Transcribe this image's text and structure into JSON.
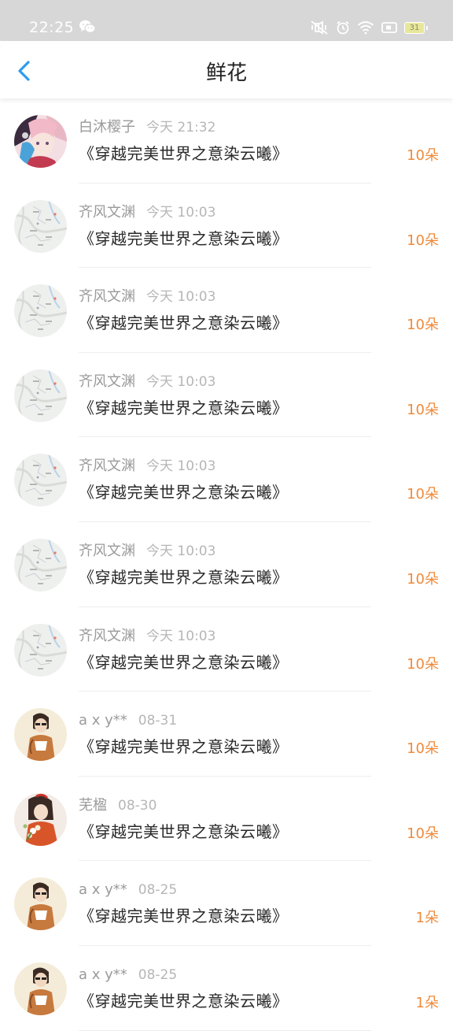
{
  "status_bar": {
    "time": "22:25",
    "left_icon": "wechat-icon",
    "right_icons": [
      "mute-vibrate-icon",
      "alarm-icon",
      "wifi-icon",
      "screen-record-icon",
      "battery-icon"
    ],
    "battery_level": "31"
  },
  "header": {
    "back_icon": "chevron-left-icon",
    "title": "鲜花"
  },
  "colors": {
    "accent": "#2f9bf0",
    "count": "#ef8a3a"
  },
  "flowers": [
    {
      "name": "白沐樱子",
      "time": "今天 21:32",
      "book": "《穿越完美世界之意染云曦》",
      "count": "10朵",
      "avatar": "anime-avatar"
    },
    {
      "name": "齐风文渊",
      "time": "今天 10:03",
      "book": "《穿越完美世界之意染云曦》",
      "count": "10朵",
      "avatar": "map-avatar"
    },
    {
      "name": "齐风文渊",
      "time": "今天 10:03",
      "book": "《穿越完美世界之意染云曦》",
      "count": "10朵",
      "avatar": "map-avatar"
    },
    {
      "name": "齐风文渊",
      "time": "今天 10:03",
      "book": "《穿越完美世界之意染云曦》",
      "count": "10朵",
      "avatar": "map-avatar"
    },
    {
      "name": "齐风文渊",
      "time": "今天 10:03",
      "book": "《穿越完美世界之意染云曦》",
      "count": "10朵",
      "avatar": "map-avatar"
    },
    {
      "name": "齐风文渊",
      "time": "今天 10:03",
      "book": "《穿越完美世界之意染云曦》",
      "count": "10朵",
      "avatar": "map-avatar"
    },
    {
      "name": "齐风文渊",
      "time": "今天 10:03",
      "book": "《穿越完美世界之意染云曦》",
      "count": "10朵",
      "avatar": "map-avatar"
    },
    {
      "name": "a x y**",
      "time": "08-31",
      "book": "《穿越完美世界之意染云曦》",
      "count": "10朵",
      "avatar": "girl-coffee-avatar"
    },
    {
      "name": "芜楹",
      "time": "08-30",
      "book": "《穿越完美世界之意染云曦》",
      "count": "10朵",
      "avatar": "girl-flowers-avatar"
    },
    {
      "name": "a x y**",
      "time": "08-25",
      "book": "《穿越完美世界之意染云曦》",
      "count": "1朵",
      "avatar": "girl-coffee-avatar"
    },
    {
      "name": "a x y**",
      "time": "08-25",
      "book": "《穿越完美世界之意染云曦》",
      "count": "1朵",
      "avatar": "girl-coffee-avatar"
    }
  ]
}
